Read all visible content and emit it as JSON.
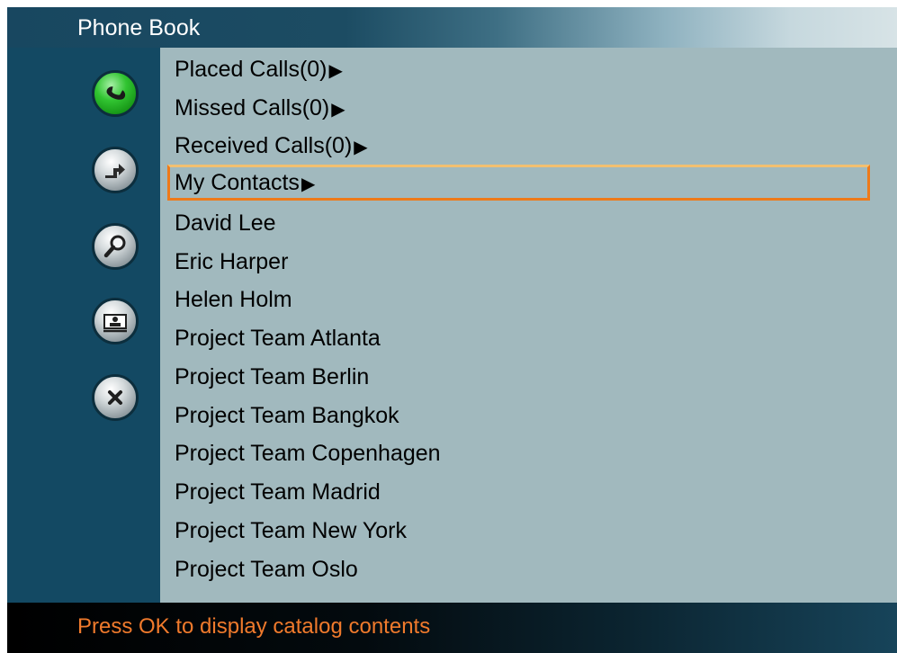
{
  "window": {
    "title": "Phone Book"
  },
  "sidebar": {
    "buttons": [
      {
        "icon": "phone-call-icon",
        "color": "#1db01d"
      },
      {
        "icon": "transfer-icon"
      },
      {
        "icon": "search-icon"
      },
      {
        "icon": "contact-card-icon"
      },
      {
        "icon": "close-icon"
      }
    ]
  },
  "list": {
    "items": [
      {
        "label": "Placed Calls(0)",
        "arrow": "▶"
      },
      {
        "label": "Missed Calls(0)",
        "arrow": "▶"
      },
      {
        "label": "Received Calls(0)",
        "arrow": "▶"
      },
      {
        "label": "My Contacts",
        "arrow": "▶",
        "selected": true
      },
      {
        "label": "David Lee"
      },
      {
        "label": "Eric Harper"
      },
      {
        "label": "Helen Holm"
      },
      {
        "label": "Project Team Atlanta"
      },
      {
        "label": "Project Team Berlin"
      },
      {
        "label": "Project Team Bangkok"
      },
      {
        "label": "Project Team Copenhagen"
      },
      {
        "label": "Project Team Madrid"
      },
      {
        "label": "Project Team New York"
      },
      {
        "label": "Project Team Oslo"
      }
    ]
  },
  "status": {
    "text": "Press OK to display catalog contents",
    "color": "#f07a2c"
  },
  "colors": {
    "selection_border": "#ee7a1a",
    "list_bg": "#a1b9be",
    "sidebar_bg": "#134963"
  }
}
